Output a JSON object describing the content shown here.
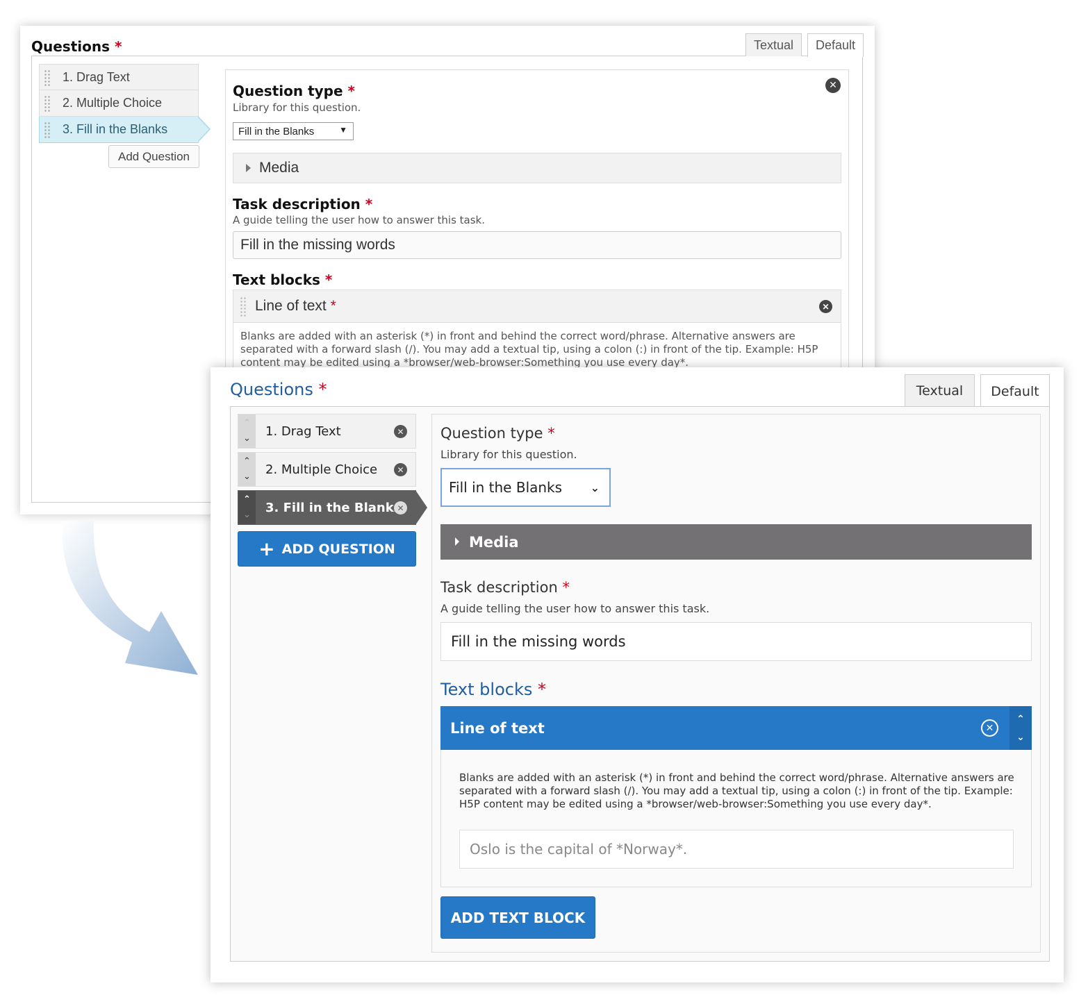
{
  "old": {
    "title": "Questions",
    "required_mark": "*",
    "tabs": [
      "Textual",
      "Default"
    ],
    "questions": [
      "1. Drag Text",
      "2. Multiple Choice",
      "3. Fill in the Blanks"
    ],
    "add_question_label": "Add Question",
    "close_glyph": "✕",
    "question_type_label": "Question type",
    "question_type_desc": "Library for this question.",
    "question_type_value": "Fill in the Blanks",
    "select_arrow": "▼",
    "media_label": "Media",
    "task_desc_label": "Task description",
    "task_desc_desc": "A guide telling the user how to answer this task.",
    "task_desc_value": "Fill in the missing words",
    "text_blocks_label": "Text blocks",
    "line_of_text_label": "Line of text",
    "help_text": "Blanks are added with an asterisk (*) in front and behind the correct word/phrase. Alternative answers are separated with a forward slash (/). You may add a textual tip, using a colon (:) in front of the tip. Example: H5P content may be edited using a *browser/web-browser:Something you use every day*."
  },
  "new": {
    "title": "Questions",
    "required_mark": "*",
    "tabs": [
      "Textual",
      "Default"
    ],
    "questions": [
      "1. Drag Text",
      "2. Multiple Choice",
      "3. Fill in the Blanks"
    ],
    "order_up": "⌃",
    "order_down": "⌄",
    "close_glyph": "✕",
    "add_question_plus": "+",
    "add_question_label": "ADD QUESTION",
    "question_type_label": "Question type",
    "question_type_desc": "Library for this question.",
    "question_type_value": "Fill in the Blanks",
    "select_chevron": "⌄",
    "media_label": "Media",
    "task_desc_label": "Task description",
    "task_desc_desc": "A guide telling the user how to answer this task.",
    "task_desc_value": "Fill in the missing words",
    "text_blocks_label": "Text blocks",
    "line_of_text_label": "Line of text",
    "help_text": "Blanks are added with an asterisk (*) in front and behind the correct word/phrase. Alternative answers are separated with a forward slash (/). You may add a textual tip, using a colon (:) in front of the tip. Example: H5P content may be edited using a *browser/web-browser:Something you use every day*.",
    "text_block_placeholder": "Oslo is the capital of *Norway*.",
    "add_text_block_label": "ADD TEXT BLOCK"
  },
  "colors": {
    "accent_blue": "#2579c6",
    "title_blue": "#215ea0",
    "required_red": "#d0021b",
    "active_gray": "#5f5f5f",
    "media_gray": "#737173",
    "old_active_cyan": "#d6eef5"
  }
}
